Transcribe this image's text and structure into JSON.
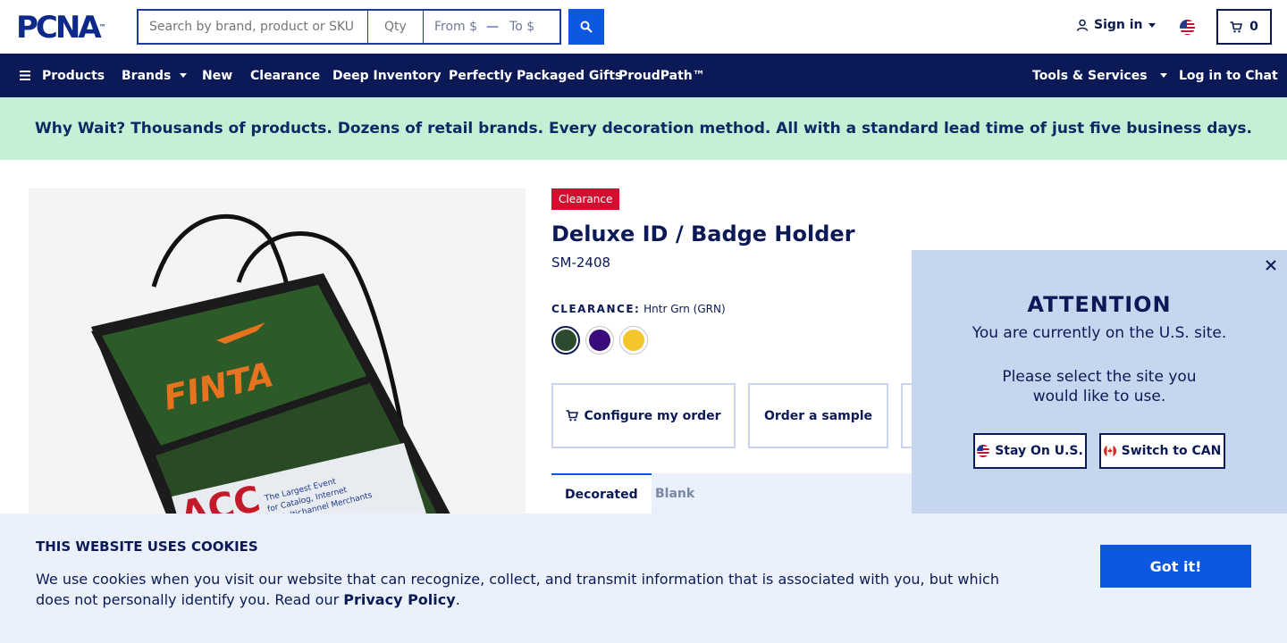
{
  "header": {
    "logo": "PCNA",
    "logo_tm": "™",
    "search_placeholder": "Search by brand, product or SKU",
    "qty_placeholder": "Qty",
    "price_from": "From $",
    "price_dash": "—",
    "price_to": "To $",
    "sign_in": "Sign in",
    "cart_count": "0"
  },
  "nav": {
    "products": "Products",
    "brands": "Brands",
    "new": "New",
    "clearance": "Clearance",
    "deep_inventory": "Deep Inventory",
    "gifts": "Perfectly Packaged Gifts",
    "proudpath": "ProudPath™",
    "tools": "Tools & Services",
    "chat": "Log in to Chat"
  },
  "banner": {
    "text": "Why Wait? Thousands of products. Dozens of retail brands. Every decoration method. All with a standard lead time of just five business days."
  },
  "product": {
    "badge": "Clearance",
    "title": "Deluxe ID / Badge Holder",
    "sku": "SM-2408",
    "color_label": "CLEARANCE:",
    "color_value": "Hntr Grn (GRN)",
    "swatches": [
      {
        "name": "Hntr Grn",
        "color": "#2b4a2e"
      },
      {
        "name": "Purple",
        "color": "#3a0b7a"
      },
      {
        "name": "Yellow",
        "color": "#f5c52e"
      }
    ],
    "configure": "Configure my order",
    "sample": "Order a sample",
    "tab_decorated": "Decorated",
    "tab_blank": "Blank",
    "image_logo": "FINTA",
    "image_card_line1": "The Largest Event",
    "image_card_line2": "for Catalog, Internet",
    "image_card_line3": "& Multichannel Merchants",
    "image_card_brand": "ACC"
  },
  "popup": {
    "heading": "ATTENTION",
    "line1": "You are currently on the U.S. site.",
    "line2": "Please select the site you would like to use.",
    "stay": "Stay On U.S.",
    "switch": "Switch to CAN"
  },
  "cookies": {
    "heading": "THIS WEBSITE USES COOKIES",
    "text": "We use cookies when you visit our website that can recognize, collect, and transmit information that is associated with you, but which does not personally identify you. Read our",
    "link": "Privacy Policy",
    "period": ".",
    "button": "Got it!"
  },
  "colors": {
    "navy": "#0b1a57",
    "accent_blue": "#0d58e0",
    "clearance_red": "#d20f2f",
    "banner_green": "#c6f0d6"
  }
}
